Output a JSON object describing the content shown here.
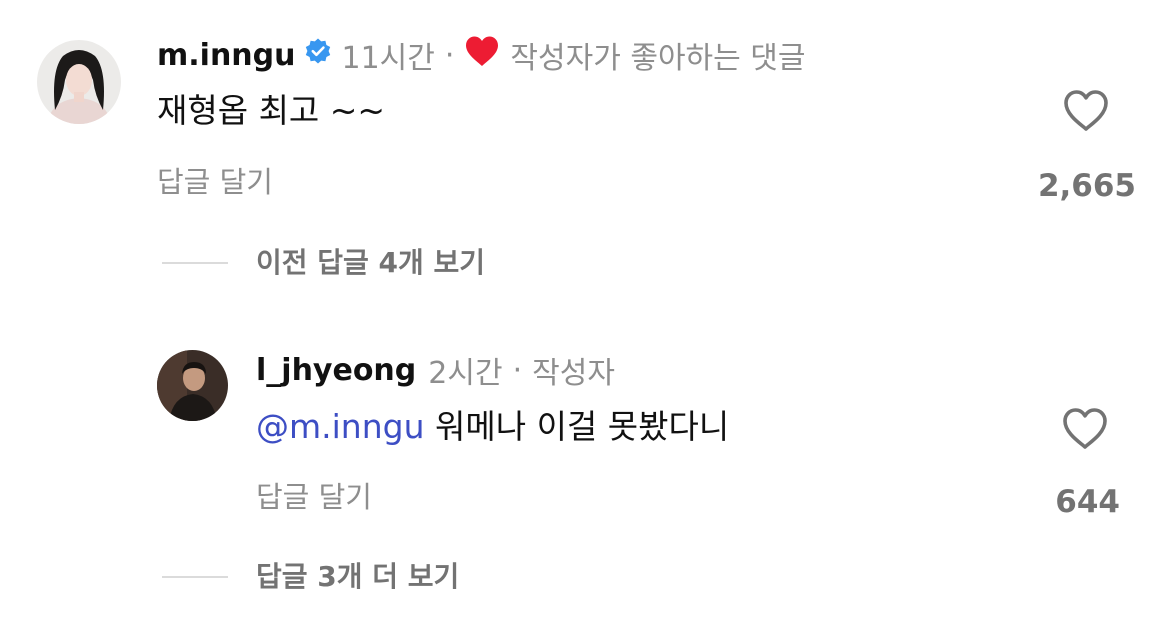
{
  "comment": {
    "username": "m.inngu",
    "time": "11시간",
    "separator": "·",
    "liked_by_author_label": "작성자가 좋아하는 댓글",
    "text": "재형옵 최고 ~~",
    "reply_label": "답글 달기",
    "like_count": "2,665",
    "icons": [
      "avatar",
      "verified-badge-icon",
      "red-heart-icon",
      "heart-outline-icon"
    ],
    "colors": {
      "verified": "#3897f0",
      "heart": "#ed1c33"
    }
  },
  "view_previous_replies": "이전 답글 4개 보기",
  "reply": {
    "username": "l_jhyeong",
    "time": "2시간",
    "separator": "·",
    "author_label": "작성자",
    "mention": "@m.inngu",
    "text": "워메나 이걸 못봤다니",
    "reply_label": "답글 달기",
    "like_count": "644",
    "icons": [
      "avatar",
      "heart-outline-icon"
    ],
    "colors": {
      "mention": "#3d4ec4"
    }
  },
  "view_more_replies": "답글 3개 더 보기"
}
